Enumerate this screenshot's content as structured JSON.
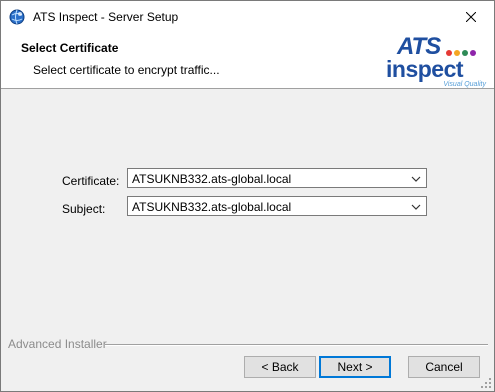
{
  "window": {
    "title": "ATS Inspect - Server Setup",
    "app_icon": "installer-globe-icon",
    "close_icon": "close-icon"
  },
  "header": {
    "title": "Select Certificate",
    "subtitle": "Select certificate to encrypt traffic...",
    "logo": {
      "top": "ATS",
      "main": "inspect",
      "tagline": "Visual Quality",
      "dot_colors": [
        "#e53935",
        "#f5a623",
        "#2e8b57",
        "#8e24aa"
      ]
    }
  },
  "form": {
    "certificate_label": "Certificate:",
    "certificate_value": "ATSUKNB332.ats-global.local",
    "subject_label": "Subject:",
    "subject_value": "ATSUKNB332.ats-global.local"
  },
  "footer": {
    "brand": "Advanced Installer",
    "back_label": "< Back",
    "next_label": "Next >",
    "cancel_label": "Cancel"
  },
  "colors": {
    "logo_blue": "#1f4fa0",
    "logo_light_blue": "#5aa0d8",
    "default_button_border": "#0078d7"
  }
}
